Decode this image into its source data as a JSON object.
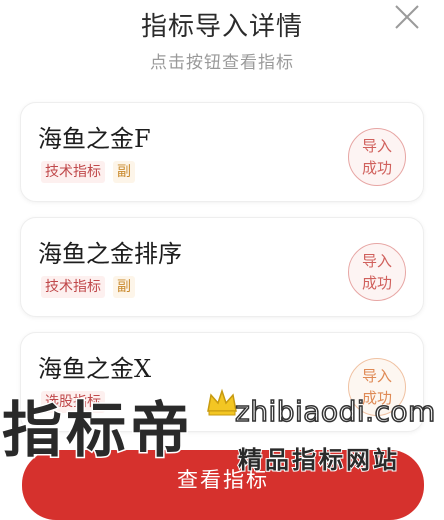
{
  "dialog": {
    "title": "指标导入详情",
    "subtitle": "点击按钮查看指标"
  },
  "indicators": [
    {
      "name": "海鱼之金F",
      "type_tag": "技术指标",
      "sub_tag": "副",
      "status": [
        "导入",
        "成功"
      ]
    },
    {
      "name": "海鱼之金排序",
      "type_tag": "技术指标",
      "sub_tag": "副",
      "status": [
        "导入",
        "成功"
      ]
    },
    {
      "name": "海鱼之金X",
      "type_tag": "选股指标",
      "sub_tag": "",
      "status": [
        "导入",
        "成功"
      ]
    }
  ],
  "view_button_label": "查看指标",
  "watermark": {
    "logo_text": "指标帝",
    "domain": "zhibiaodi.com",
    "slogan": "精品指标网站"
  },
  "colors": {
    "accent": "#d6312d",
    "tag_red": "#c0494b",
    "tag_orange": "#c98a2e",
    "stamp_red": "#d0605c",
    "stamp_orange": "#df8a55"
  },
  "icons": {
    "close": "close-icon",
    "crown": "crown-icon"
  }
}
